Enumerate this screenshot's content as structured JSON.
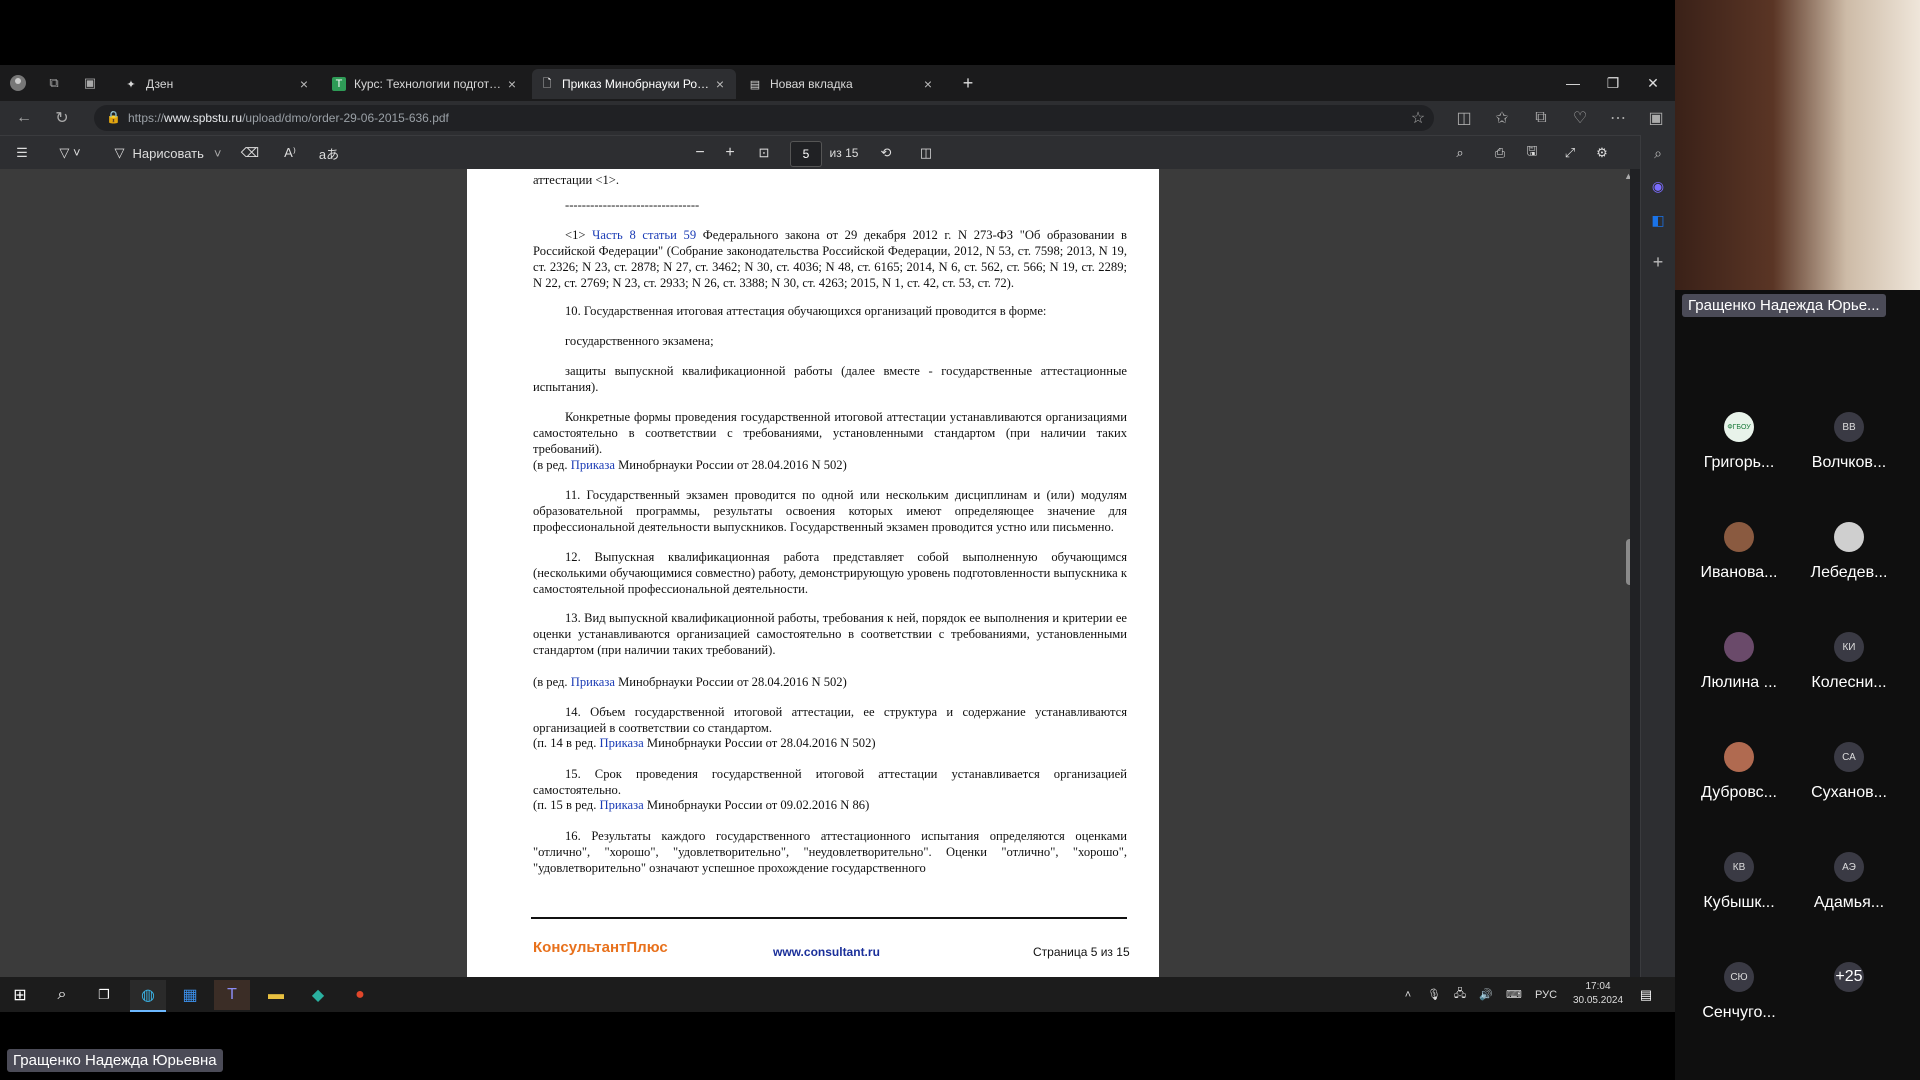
{
  "tabs": [
    {
      "label": "Дзен",
      "icon": "sparkle-icon"
    },
    {
      "label": "Курс: Технологии подготовки и",
      "icon": "course-icon"
    },
    {
      "label": "Приказ Минобрнауки России о",
      "icon": "document-icon",
      "active": true
    },
    {
      "label": "Новая вкладка",
      "icon": "newtab-icon"
    }
  ],
  "address": {
    "prefix": "https://",
    "domain": "www.spbstu.ru",
    "path": "/upload/dmo/order-29-06-2015-636.pdf"
  },
  "pdf_toolbar": {
    "draw_label": "Нарисовать",
    "page_current": "5",
    "page_total": "из 15",
    "zoom_minus": "−",
    "zoom_plus": "+"
  },
  "document": {
    "top_line": "аттестации <1>.",
    "separator": "--------------------------------",
    "footnote_pre": "<1> ",
    "footnote_link": "Часть 8 статьи 59",
    "footnote_text": " Федерального закона от 29 декабря 2012 г. N 273-ФЗ \"Об образовании в Российской Федерации\" (Собрание законодательства Российской Федерации, 2012, N 53, ст. 7598; 2013, N 19, ст. 2326; N 23, ст. 2878; N 27, ст. 3462; N 30, ст. 4036; N 48, ст. 6165; 2014, N 6, ст. 562, ст. 566; N 19, ст. 2289; N 22, ст. 2769; N 23, ст. 2933; N 26, ст. 3388; N 30, ст. 4263; 2015, N 1, ст. 42, ст. 53, ст. 72).",
    "p10": "10. Государственная итоговая аттестация обучающихся организаций проводится в форме:",
    "p10a": "государственного экзамена;",
    "p10b": "защиты выпускной квалификационной работы (далее вместе - государственные аттестационные испытания).",
    "p10c": "Конкретные формы проведения государственной итоговой аттестации устанавливаются организациями самостоятельно в соответствии с требованиями, установленными стандартом (при наличии таких требований).",
    "red_pre": "(в ред. ",
    "red_link": "Приказа",
    "red_post_1": " Минобрнауки России от 28.04.2016 N 502)",
    "p11": "11. Государственный экзамен проводится по одной или нескольким дисциплинам и (или) модулям образовательной программы, результаты освоения которых имеют определяющее значение для профессиональной деятельности выпускников. Государственный экзамен проводится устно или письменно.",
    "p12": "12. Выпускная квалификационная работа представляет собой выполненную обучающимся (несколькими обучающимися совместно) работу, демонстрирующую уровень подготовленности выпускника к самостоятельной профессиональной деятельности.",
    "p13": "13. Вид выпускной квалификационной работы, требования к ней, порядок ее выполнения и критерии ее оценки устанавливаются организацией самостоятельно в соответствии с требованиями, установленными стандартом (при наличии таких требований).",
    "p14": "14. Объем государственной итоговой аттестации, ее структура и содержание устанавливаются организацией в соответствии со стандартом.",
    "p14_pre": "(п. 14 в ред. ",
    "p14_post": " Минобрнауки России от 28.04.2016 N 502)",
    "p15": "15. Срок проведения государственной итоговой аттестации устанавливается организацией самостоятельно.",
    "p15_pre": "(п. 15 в ред. ",
    "p15_post": " Минобрнауки России от 09.02.2016 N 86)",
    "p16": "16. Результаты каждого государственного аттестационного испытания определяются оценками \"отлично\", \"хорошо\", \"удовлетворительно\", \"неудовлетворительно\". Оценки \"отлично\", \"хорошо\", \"удовлетворительно\" означают успешное прохождение государственного",
    "footer_brand": "КонсультантПлюс",
    "footer_url": "www.consultant.ru",
    "footer_page": "Страница 5 из 15"
  },
  "taskbar": {
    "lang": "РУС",
    "time": "17:04",
    "date": "30.05.2024"
  },
  "conference": {
    "presenter_top": "Гращенко Надежда Юрье...",
    "presenter_bottom": "Гращенко Надежда Юрьевна",
    "participants": [
      {
        "name": "Григорь...",
        "initials": "ФГБОУ"
      },
      {
        "name": "Волчков...",
        "initials": "ВВ"
      },
      {
        "name": "Иванова...",
        "initials": ""
      },
      {
        "name": "Лебедев...",
        "initials": ""
      },
      {
        "name": "Люлина ...",
        "initials": ""
      },
      {
        "name": "Колесни...",
        "initials": "КИ"
      },
      {
        "name": "Дубровс...",
        "initials": ""
      },
      {
        "name": "Суханов...",
        "initials": "СА"
      },
      {
        "name": "Кубышк...",
        "initials": "КВ"
      },
      {
        "name": "Адамья...",
        "initials": "АЭ"
      },
      {
        "name": "Сенчуго...",
        "initials": "СЮ"
      }
    ],
    "more_count": "+25"
  }
}
